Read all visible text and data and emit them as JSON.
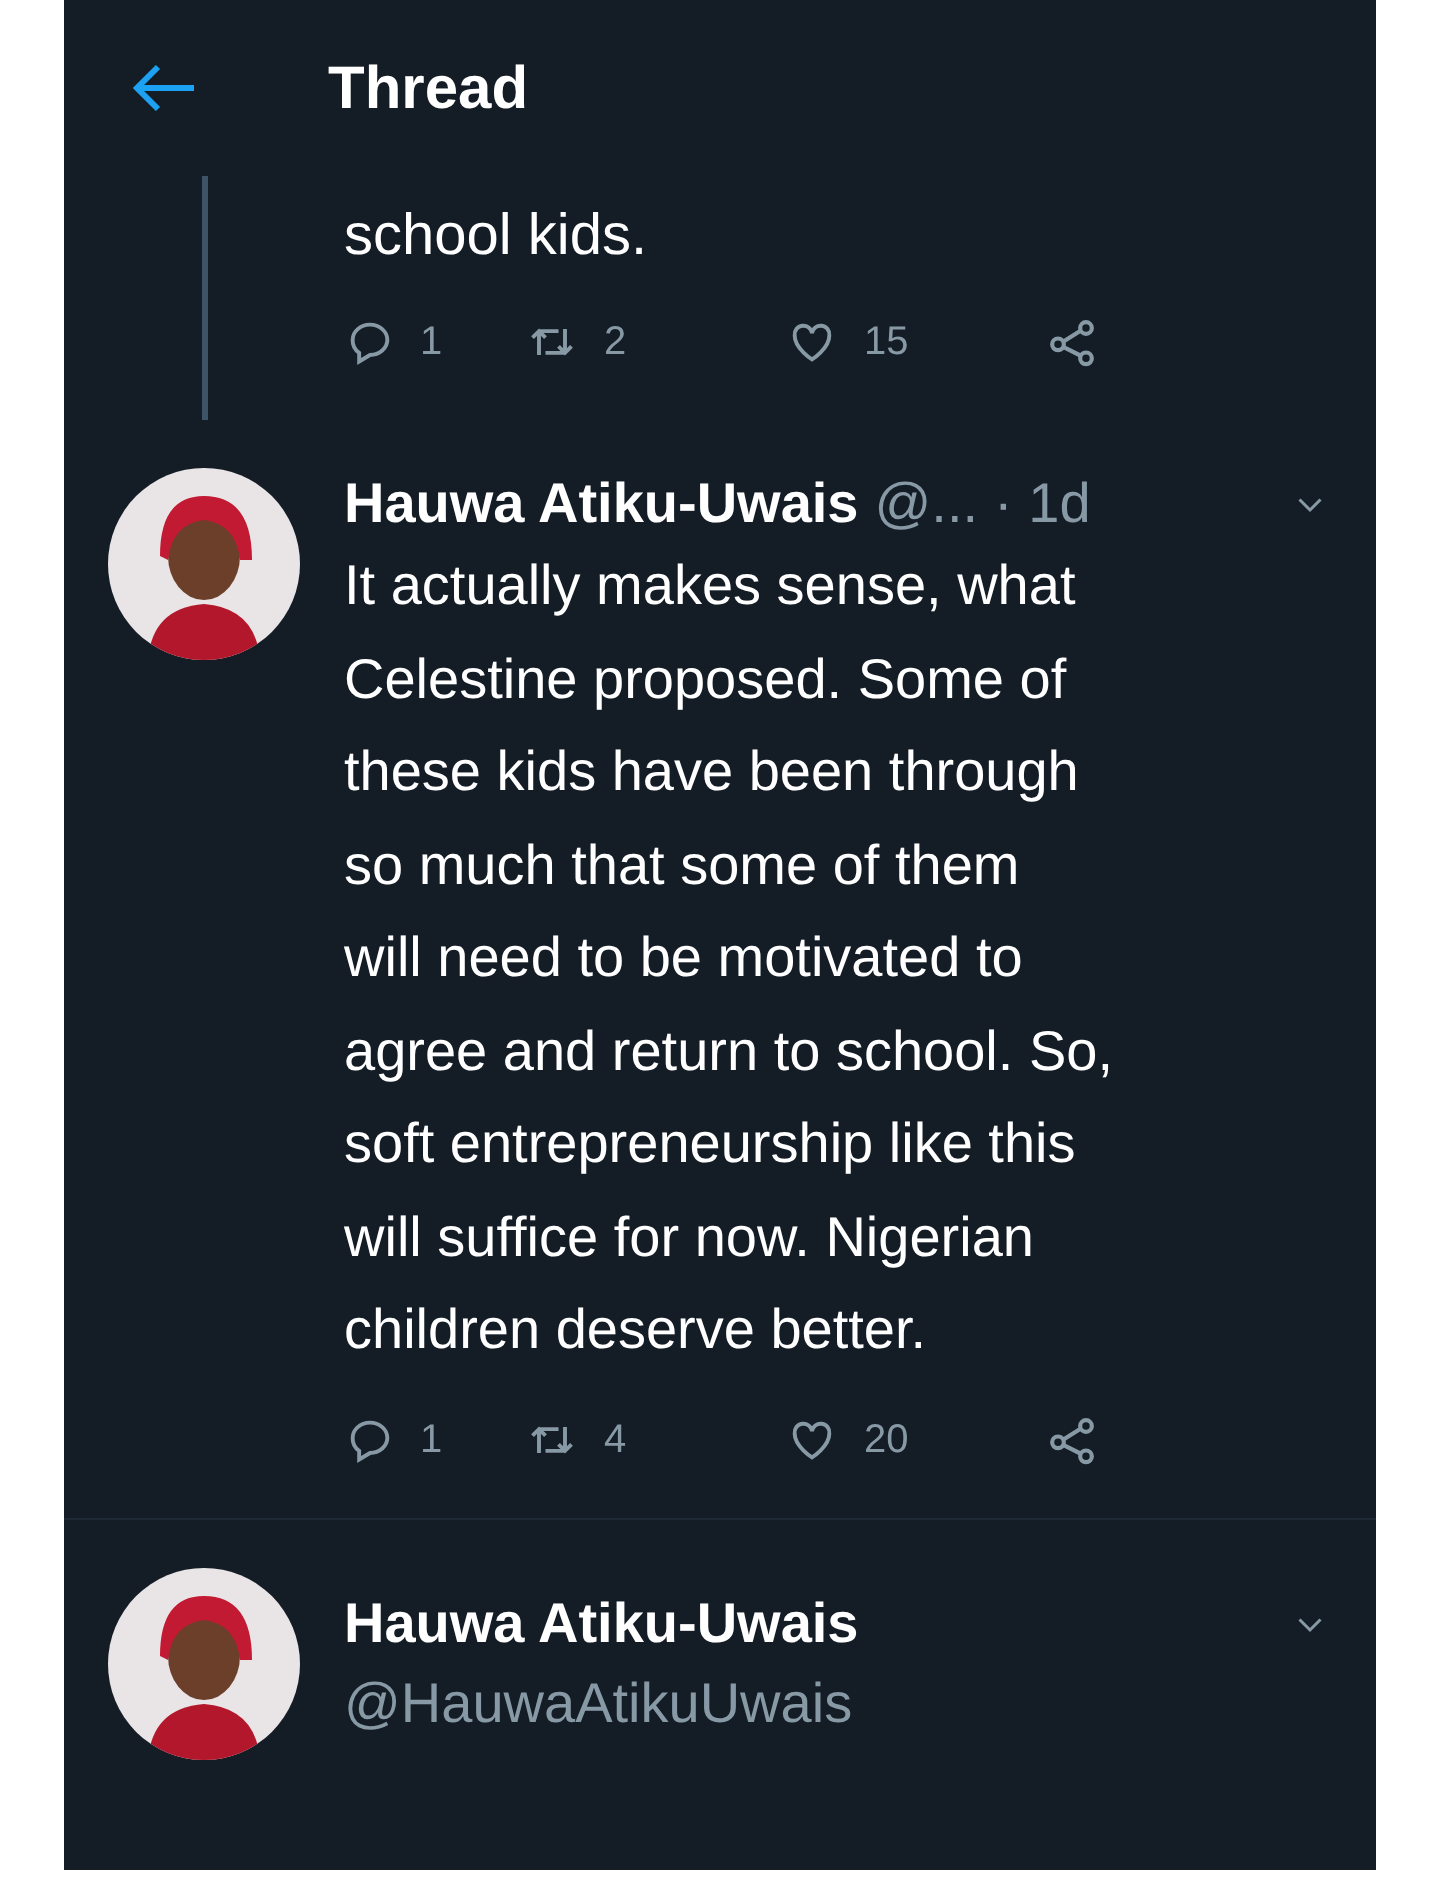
{
  "header": {
    "title": "Thread"
  },
  "tweets": [
    {
      "kind": "partial",
      "text": "school kids.",
      "actions": {
        "replies": "1",
        "retweets": "2",
        "likes": "15"
      }
    },
    {
      "kind": "full",
      "name": "Hauwa Atiku-Uwais",
      "handle": "@...",
      "time": "· 1d",
      "text": "It actually makes sense, what\nCelestine proposed. Some of\nthese kids have been through\nso much that some of them\nwill need to be motivated to\nagree and return to school. So,\nsoft entrepreneurship like this\nwill suffice for now. Nigerian\nchildren deserve better.",
      "actions": {
        "replies": "1",
        "retweets": "4",
        "likes": "20"
      }
    },
    {
      "kind": "profile",
      "name": "Hauwa Atiku-Uwais",
      "handle": "@HauwaAtikuUwais"
    }
  ]
}
